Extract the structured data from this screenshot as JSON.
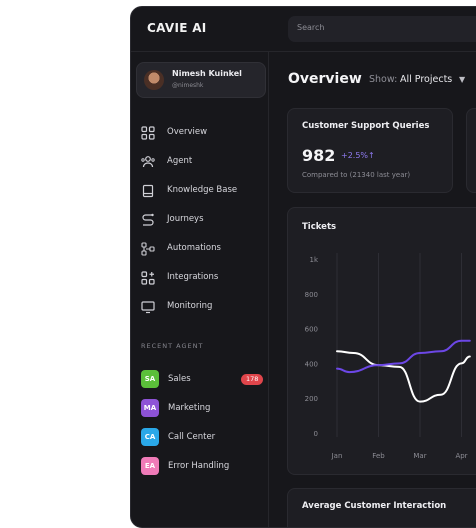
{
  "app": {
    "logo": "CAVIE AI"
  },
  "search": {
    "placeholder": "Search"
  },
  "user": {
    "name": "Nimesh Kuinkel",
    "handle": "@nimeshk"
  },
  "nav": {
    "items": [
      {
        "label": "Overview",
        "icon": "grid-icon"
      },
      {
        "label": "Agent",
        "icon": "agent-icon"
      },
      {
        "label": "Knowledge Base",
        "icon": "book-icon"
      },
      {
        "label": "Journeys",
        "icon": "journey-icon"
      },
      {
        "label": "Automations",
        "icon": "flow-icon"
      },
      {
        "label": "Integrations",
        "icon": "integrations-icon"
      },
      {
        "label": "Monitoring",
        "icon": "monitor-icon"
      }
    ]
  },
  "recent_agents": {
    "title": "RECENT AGENT",
    "items": [
      {
        "initials": "SA",
        "label": "Sales",
        "color": "#5bbf3a",
        "count": "178"
      },
      {
        "initials": "MA",
        "label": "Marketing",
        "color": "#8e53d6"
      },
      {
        "initials": "CA",
        "label": "Call Center",
        "color": "#2aa8e8"
      },
      {
        "initials": "EA",
        "label": "Error Handling",
        "color": "#f07bb8"
      }
    ]
  },
  "main": {
    "title": "Overview",
    "show_label": "Show:",
    "show_value": "All Projects"
  },
  "kpi": {
    "title": "Customer Support Queries",
    "value": "982",
    "change": "+2.5%↑",
    "subtitle": "Compared to (21340 last year)"
  },
  "bottom_card": {
    "title": "Average Customer Interaction"
  },
  "chart_data": {
    "type": "line",
    "title": "Tickets",
    "categories": [
      "Jan",
      "Feb",
      "Mar",
      "Apr"
    ],
    "y_ticks": [
      "1k",
      "800",
      "600",
      "400",
      "200",
      "0"
    ],
    "ylim": [
      0,
      1000
    ],
    "grid": true,
    "series": [
      {
        "color": "#ffffff",
        "x": [
          0,
          0.4,
          1,
          1.5,
          2,
          2.5,
          3,
          3.2
        ],
        "values": [
          470,
          460,
          390,
          380,
          180,
          220,
          400,
          440
        ]
      },
      {
        "color": "#6c47e6",
        "x": [
          0,
          0.3,
          1,
          1.5,
          2,
          2.5,
          3,
          3.2
        ],
        "values": [
          370,
          350,
          390,
          400,
          460,
          470,
          530,
          530
        ]
      }
    ]
  }
}
